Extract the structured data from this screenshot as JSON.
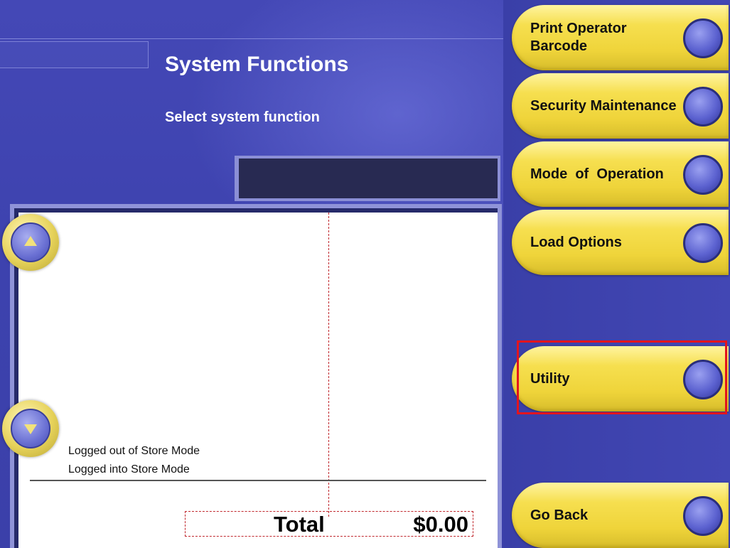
{
  "header": {
    "title": "System Functions",
    "subtitle": "Select system function"
  },
  "receipt": {
    "log_lines": [
      "Logged out of Store Mode",
      "Logged into Store Mode"
    ],
    "total_label": "Total",
    "total_value": "$0.00"
  },
  "function_buttons": [
    {
      "label": "Print Operator Barcode"
    },
    {
      "label": "Security Maintenance"
    },
    {
      "label": "Mode  of  Operation"
    },
    {
      "label": "Load Options"
    },
    {
      "label": "Utility"
    },
    {
      "label": "Go Back"
    }
  ],
  "icons": {
    "scroll_up": "triangle-up",
    "scroll_down": "triangle-down",
    "button_knob": "circle"
  },
  "colors": {
    "background": "#3e43b3",
    "button_yellow": "#f6df4f",
    "highlight": "#e3141e",
    "total_border": "#c0272d"
  }
}
